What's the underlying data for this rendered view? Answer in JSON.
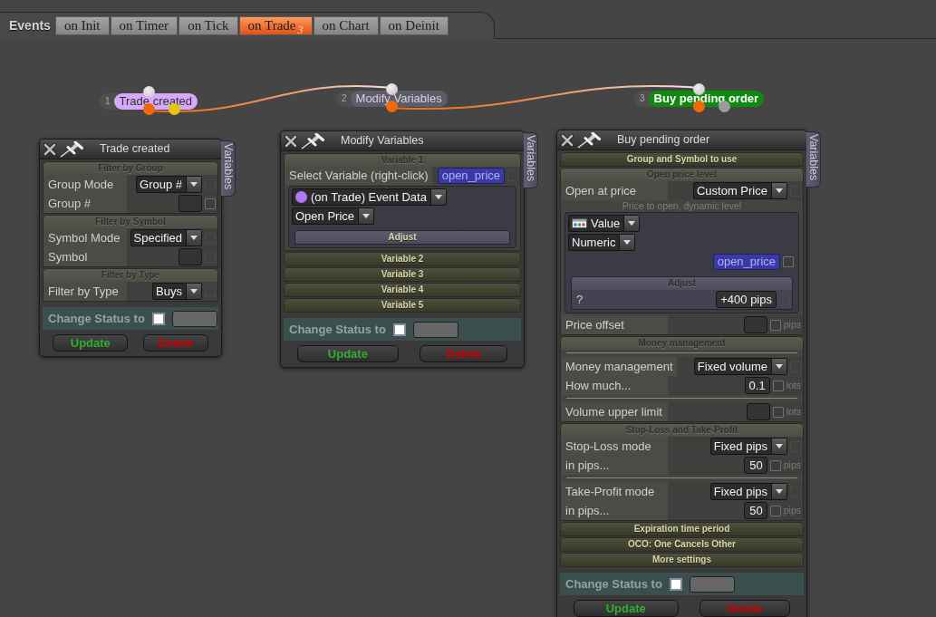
{
  "toolbar": {
    "label": "Events"
  },
  "tabs": [
    {
      "label": "on Init",
      "selected": false
    },
    {
      "label": "on Timer",
      "selected": false
    },
    {
      "label": "on Tick",
      "selected": false
    },
    {
      "label": "on Trade",
      "count": "3",
      "selected": true
    },
    {
      "label": "on Chart",
      "selected": false
    },
    {
      "label": "on Deinit",
      "selected": false
    }
  ],
  "nodes": [
    {
      "number": "1",
      "label": "Trade created",
      "color": "#d7a9fc",
      "selected": false,
      "outputs": [
        {
          "color": "#f06a0c"
        },
        {
          "color": "#e9c40a"
        }
      ]
    },
    {
      "number": "2",
      "label": "Modify Variables",
      "color": "#5d5c68",
      "selected": false,
      "outputs": [
        {
          "color": "#f06a0c"
        }
      ]
    },
    {
      "number": "3",
      "label": "Buy pending order",
      "color": "#0f8a0f",
      "selected": true,
      "outputs": [
        {
          "color": "#f06a0c"
        },
        {
          "color": "#9c9c9c"
        }
      ]
    }
  ],
  "panels": [
    {
      "title": "Trade created",
      "side_tab": "Variables",
      "sections": [
        {
          "title": "Filter by Group",
          "expanded": true,
          "rows": [
            {
              "kind": "select",
              "label": "Group Mode",
              "value": "Group #",
              "checked": false,
              "disabled": true
            },
            {
              "kind": "input",
              "label": "Group #",
              "checked": false,
              "disabled": false
            }
          ]
        },
        {
          "title": "Filter by Symbol",
          "expanded": true,
          "rows": [
            {
              "kind": "select",
              "label": "Symbol Mode",
              "value": "Specified",
              "checked": false,
              "disabled": true
            },
            {
              "kind": "input",
              "label": "Symbol",
              "checked": false,
              "disabled": true
            }
          ]
        },
        {
          "title": "Filter by Type",
          "expanded": true,
          "rows": [
            {
              "kind": "select",
              "label": "Filter by Type",
              "value": "Buys",
              "checked": false,
              "disabled": true
            }
          ]
        }
      ],
      "status": {
        "label": "Change Status to",
        "checked": false
      },
      "buttons": [
        {
          "label": "Update",
          "color": "#2fae2f"
        },
        {
          "label": "Delete",
          "color": "#cc0000"
        }
      ]
    },
    {
      "title": "Modify Variables",
      "side_tab": "Variables",
      "sections": [
        {
          "title": "Variable 1",
          "expanded": true,
          "rows": [
            {
              "kind": "chip",
              "label": "Select Variable (right-click)",
              "value": "open_price",
              "checked": false,
              "disabled": true
            },
            {
              "kind": "box",
              "rows": [
                {
                  "kind": "source",
                  "value": "(on Trade) Event Data",
                  "color": "#b07af5"
                },
                {
                  "kind": "dropdown",
                  "value": "Open Price"
                },
                {
                  "kind": "section",
                  "title": "Adjust",
                  "expanded": false
                }
              ]
            }
          ]
        },
        {
          "title": "Variable 2",
          "expanded": false
        },
        {
          "title": "Variable 3",
          "expanded": false
        },
        {
          "title": "Variable 4",
          "expanded": false
        },
        {
          "title": "Variable 5",
          "expanded": false
        }
      ],
      "status": {
        "label": "Change Status to",
        "checked": false
      },
      "buttons": [
        {
          "label": "Update",
          "color": "#2fae2f"
        },
        {
          "label": "Delete",
          "color": "#cc0000"
        }
      ]
    },
    {
      "title": "Buy pending order",
      "side_tab": "Variables",
      "sections": [
        {
          "title": "Group and Symbol to use",
          "expanded": false
        },
        {
          "title": "Open price level",
          "expanded": true,
          "rows": [
            {
              "kind": "select",
              "label": "Open at price",
              "value": "Custom Price",
              "checked": false,
              "disabled": true
            },
            {
              "kind": "caption",
              "text": "Price to open, dynamic level"
            },
            {
              "kind": "box",
              "rows": [
                {
                  "kind": "valuetype",
                  "value": "Value"
                },
                {
                  "kind": "dropdown",
                  "value": "Numeric"
                },
                {
                  "kind": "chip",
                  "value": "open_price",
                  "checked": false,
                  "disabled": false
                },
                {
                  "kind": "section",
                  "title": "Adjust",
                  "expanded": true,
                  "rows": [
                    {
                      "kind": "input",
                      "label": "?",
                      "value": "+400 pips",
                      "checked": false,
                      "disabled": true
                    }
                  ]
                }
              ]
            },
            {
              "kind": "input",
              "label": "Price offset",
              "unit": "pips",
              "checked": false,
              "disabled": false
            }
          ]
        },
        {
          "title": "Money management",
          "expanded": true,
          "rows": [
            {
              "kind": "divider"
            },
            {
              "kind": "select",
              "label": "Money management",
              "value": "Fixed volume",
              "checked": false,
              "disabled": true
            },
            {
              "kind": "input",
              "label": "How much...",
              "value": "0.1",
              "unit": "lots",
              "checked": false,
              "disabled": false
            },
            {
              "kind": "divider"
            },
            {
              "kind": "input",
              "label": "Volume upper limit",
              "unit": "lots",
              "checked": false,
              "disabled": false
            }
          ]
        },
        {
          "title": "Stop-Loss and Take-Profit",
          "expanded": true,
          "rows": [
            {
              "kind": "select",
              "label": "Stop-Loss mode",
              "value": "Fixed pips",
              "checked": false,
              "disabled": true
            },
            {
              "kind": "input",
              "label": "in pips...",
              "value": "50",
              "unit": "pips",
              "checked": false,
              "disabled": false
            },
            {
              "kind": "divider"
            },
            {
              "kind": "select",
              "label": "Take-Profit mode",
              "value": "Fixed pips",
              "checked": false,
              "disabled": true
            },
            {
              "kind": "input",
              "label": "in pips...",
              "value": "50",
              "unit": "pips",
              "checked": false,
              "disabled": false
            }
          ]
        },
        {
          "title": "Expiration time period",
          "expanded": false
        },
        {
          "title": "OCO: One Cancels Other",
          "expanded": false
        },
        {
          "title": "More settings",
          "expanded": false
        }
      ],
      "status": {
        "label": "Change Status to",
        "checked": false
      },
      "buttons": [
        {
          "label": "Update",
          "color": "#2fae2f"
        },
        {
          "label": "Delete",
          "color": "#cc0000"
        }
      ]
    }
  ]
}
